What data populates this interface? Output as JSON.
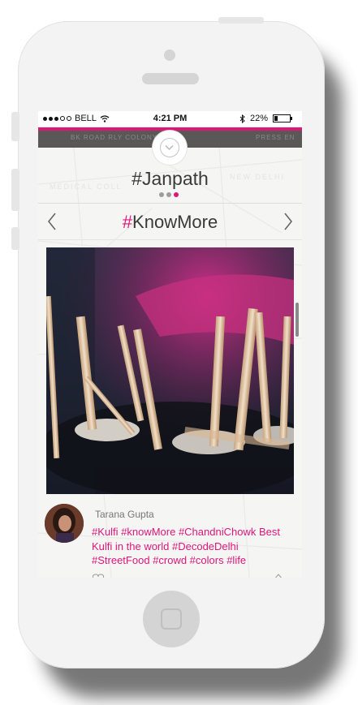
{
  "status_bar": {
    "carrier": "BELL",
    "time": "4:21 PM",
    "battery": "22%",
    "battery_level": 0.22
  },
  "map_labels": {
    "top_left": "BK ROAD RLY COLONY",
    "top_right": "PRESS EN",
    "new_delhi": "NEW DELHI",
    "medical": "MEDICAL COLL"
  },
  "location": {
    "title": "#Janpath",
    "pages": 3,
    "active_page": 3
  },
  "section": {
    "hash": "#",
    "title": "KnowMore"
  },
  "post": {
    "author": "Tarana Gupta",
    "caption": "#Kulfi #knowMore #ChandniChowk Best Kulfi in the world #DecodeDelhi #StreetFood #crowd #colors #life"
  },
  "colors": {
    "accent": "#e0157a",
    "phone_body": "#f3f3f3",
    "text": "#3a3a3a"
  },
  "icons": [
    "wifi-icon",
    "bluetooth-icon",
    "battery-icon",
    "chevron-down-icon",
    "chevron-left-icon",
    "chevron-right-icon",
    "heart-icon",
    "share-icon"
  ]
}
